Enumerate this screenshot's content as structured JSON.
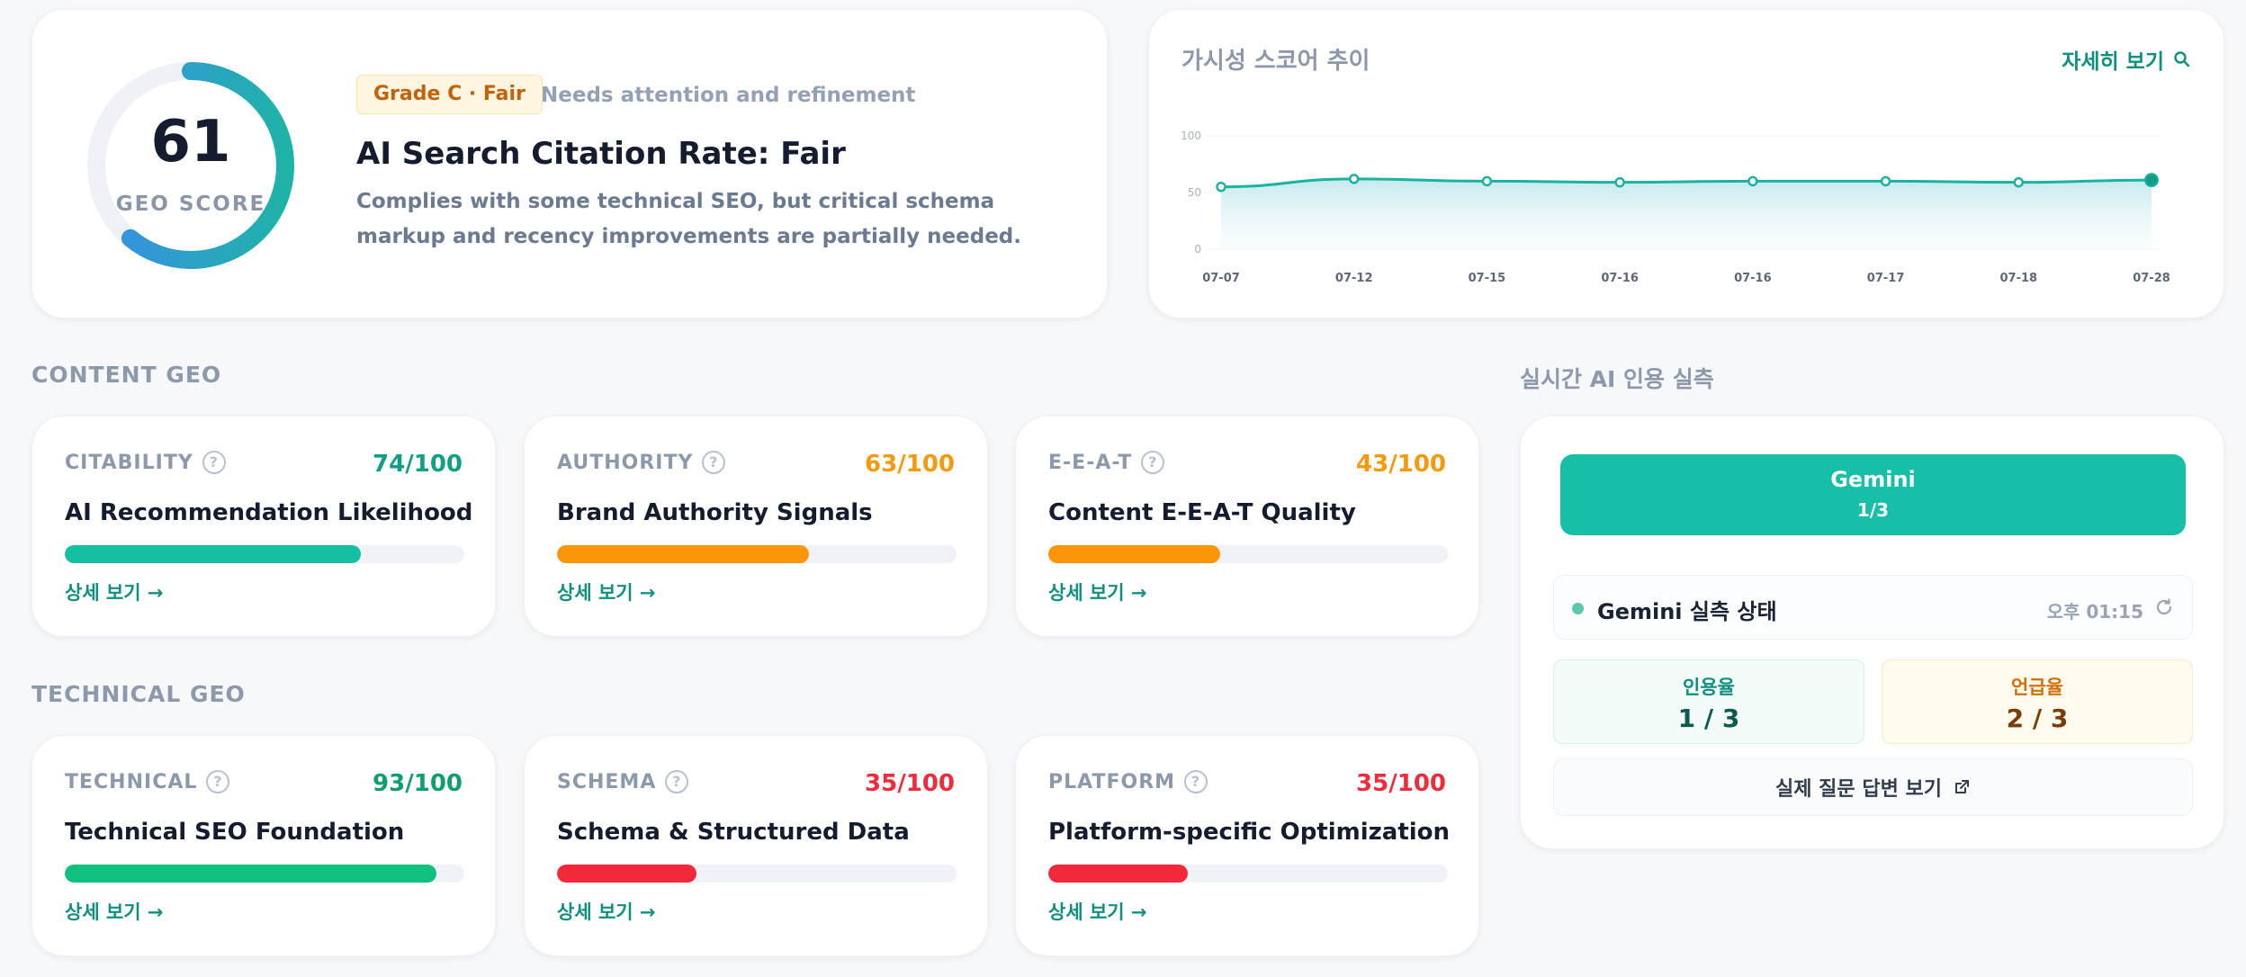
{
  "score": {
    "value": "61",
    "fraction": 0.61,
    "label": "GEO SCORE",
    "grade_badge": "Grade C · Fair",
    "grade_note": "Needs attention and refinement",
    "title": "AI Search Citation Rate: Fair",
    "description": "Complies with some technical SEO, but critical schema markup and recency improvements are partially needed."
  },
  "trend": {
    "title": "가시성 스코어 추이",
    "link_label": "자세히 보기",
    "chart_data": {
      "type": "area",
      "x": [
        "07-07",
        "07-12",
        "07-15",
        "07-16",
        "07-16",
        "07-17",
        "07-18",
        "07-28"
      ],
      "values": [
        55,
        62,
        60,
        59,
        60,
        60,
        59,
        61
      ],
      "y_ticks": [
        "100",
        "50",
        "0"
      ],
      "ylim": [
        0,
        100
      ],
      "grid": true,
      "line_color": "#1bb3a0"
    }
  },
  "content_geo": {
    "title": "CONTENT GEO",
    "metrics": [
      {
        "name": "CITABILITY",
        "score": "74/100",
        "value": 74,
        "title": "AI Recommendation Likelihood",
        "link": "상세 보기 →",
        "color": "#0f9f86",
        "bar": "#14bfa2"
      },
      {
        "name": "AUTHORITY",
        "score": "63/100",
        "value": 63,
        "title": "Brand Authority Signals",
        "link": "상세 보기 →",
        "color": "#f59a0c",
        "bar": "#fb9509"
      },
      {
        "name": "E-E-A-T",
        "score": "43/100",
        "value": 43,
        "title": "Content E-E-A-T Quality",
        "link": "상세 보기 →",
        "color": "#f59a0c",
        "bar": "#fb9509"
      }
    ]
  },
  "technical_geo": {
    "title": "TECHNICAL GEO",
    "metrics": [
      {
        "name": "TECHNICAL",
        "score": "93/100",
        "value": 93,
        "title": "Technical SEO Foundation",
        "link": "상세 보기 →",
        "color": "#0f9f6e",
        "bar": "#10c07e"
      },
      {
        "name": "SCHEMA",
        "score": "35/100",
        "value": 35,
        "title": "Schema & Structured Data",
        "link": "상세 보기 →",
        "color": "#ef2b3c",
        "bar": "#f2293a"
      },
      {
        "name": "PLATFORM",
        "score": "35/100",
        "value": 35,
        "title": "Platform-specific Optimization",
        "link": "상세 보기 →",
        "color": "#ef2b3c",
        "bar": "#f2293a"
      }
    ]
  },
  "live": {
    "title": "실시간 AI 인용 실측",
    "tab": {
      "label": "Gemini",
      "count": "1/3"
    },
    "status_label": "Gemini 실측 상태",
    "status_time": "오후 01:15",
    "cite": {
      "label": "인용율",
      "value": "1 / 3"
    },
    "mention": {
      "label": "언급율",
      "value": "2 / 3"
    },
    "answer_button": "실제 질문 답변 보기"
  }
}
